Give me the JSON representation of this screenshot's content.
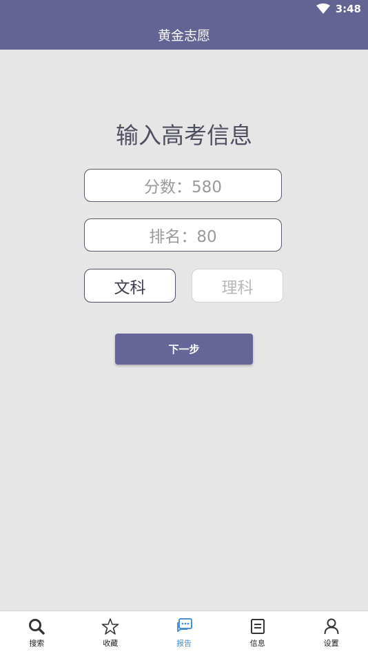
{
  "status_bar": {
    "time": "3:48"
  },
  "app_bar": {
    "title": "黄金志愿"
  },
  "form": {
    "heading": "输入高考信息",
    "score_field": "分数：580",
    "rank_field": "排名：80",
    "subject_options": [
      {
        "label": "文科",
        "selected": true
      },
      {
        "label": "理科",
        "selected": false
      }
    ],
    "next_button": "下一步"
  },
  "tab_bar": {
    "items": [
      {
        "label": "搜索",
        "icon": "search-icon",
        "active": false
      },
      {
        "label": "收藏",
        "icon": "star-icon",
        "active": false
      },
      {
        "label": "报告",
        "icon": "report-chat-icon",
        "active": true
      },
      {
        "label": "信息",
        "icon": "document-icon",
        "active": false
      },
      {
        "label": "设置",
        "icon": "person-icon",
        "active": false
      }
    ]
  },
  "colors": {
    "primary": "#636394",
    "button": "#666597",
    "active_tab": "#4a90d9",
    "background": "#e6e6e6"
  }
}
